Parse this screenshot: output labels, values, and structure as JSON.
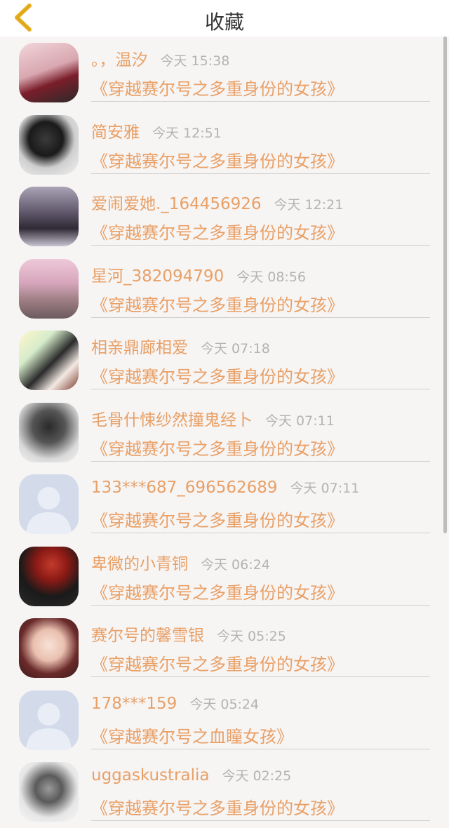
{
  "header": {
    "title": "收藏",
    "back_icon": "chevron-left-icon",
    "back_color": "#e8b020"
  },
  "colors": {
    "accent": "#e8a066",
    "time": "#b3b3b3",
    "divider": "#d2cfcf"
  },
  "items": [
    {
      "name": "。，温汐",
      "time": "今天 15:38",
      "book": "《穿越赛尔号之多重身份的女孩》",
      "avatar": "photo"
    },
    {
      "name": "简安雅",
      "time": "今天 12:51",
      "book": "《穿越赛尔号之多重身份的女孩》",
      "avatar": "photo"
    },
    {
      "name": "爱闹爱她._164456926",
      "time": "今天 12:21",
      "book": "《穿越赛尔号之多重身份的女孩》",
      "avatar": "photo"
    },
    {
      "name": "星河_382094790",
      "time": "今天 08:56",
      "book": "《穿越赛尔号之多重身份的女孩》",
      "avatar": "photo"
    },
    {
      "name": "相亲鼎廊相爱",
      "time": "今天 07:18",
      "book": "《穿越赛尔号之多重身份的女孩》",
      "avatar": "photo"
    },
    {
      "name": "毛骨什悚纱然撞鬼经卜",
      "time": "今天 07:11",
      "book": "《穿越赛尔号之多重身份的女孩》",
      "avatar": "photo"
    },
    {
      "name": "133***687_696562689",
      "time": "今天 07:11",
      "book": "《穿越赛尔号之多重身份的女孩》",
      "avatar": "default"
    },
    {
      "name": "卑微的小青铜",
      "time": "今天 06:24",
      "book": "《穿越赛尔号之多重身份的女孩》",
      "avatar": "photo"
    },
    {
      "name": "赛尔号的馨雪银",
      "time": "今天 05:25",
      "book": "《穿越赛尔号之多重身份的女孩》",
      "avatar": "photo"
    },
    {
      "name": "178***159",
      "time": "今天 05:24",
      "book": "《穿越赛尔号之血瞳女孩》",
      "avatar": "default"
    },
    {
      "name": "uggaskustralia",
      "time": "今天 02:25",
      "book": "《穿越赛尔号之多重身份的女孩》",
      "avatar": "photo"
    }
  ]
}
